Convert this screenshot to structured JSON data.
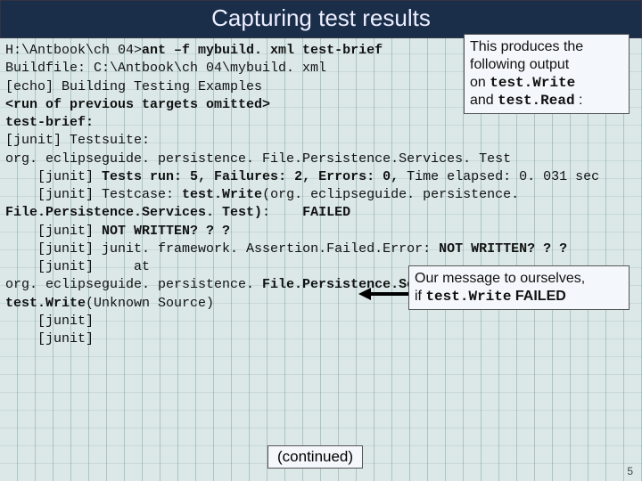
{
  "title": "Capturing test results",
  "callout1": {
    "l1": "This produces the",
    "l2": "following output",
    "l3_a": "on ",
    "l3_code": "test.Write",
    "l4_a": "and ",
    "l4_code": "test.Read",
    "l4_b": " :"
  },
  "callout2": {
    "l1": "Our message to ourselves,",
    "l2_a": "if ",
    "l2_code": "test.Write",
    "l2_b": " FAILED"
  },
  "term": {
    "l1_a": "H:\\Antbook\\ch 04>",
    "l1_b": "ant –f mybuild. xml test-brief",
    "l2": "Buildfile: C:\\Antbook\\ch 04\\mybuild. xml",
    "l3": "     [echo] Building Testing Examples",
    "l4": "<run of previous targets omitted>",
    "l5": "test-brief:",
    "l6": "    [junit] Testsuite:",
    "l7": "org. eclipseguide. persistence. File.Persistence.Services. Test",
    "l8_a": "    [junit] ",
    "l8_b": "Tests run: 5, Failures: 2, Errors: 0, ",
    "l8_c": "Time elapsed: 0. 031 sec",
    "l9_a": "    [junit] Testcase: ",
    "l9_b": "test.Write",
    "l9_c": "(org. eclipseguide. persistence.",
    "l10_a": "File.Persistence.Services. Test)",
    "l10_b": ":    ",
    "l10_c": "FAILED",
    "l11_a": "    [junit] ",
    "l11_b": "NOT WRITTEN? ? ?",
    "l12_a": "    [junit] ",
    "l12_b": "junit. framework. Assertion.Failed.Error: ",
    "l12_c": "NOT WRITTEN? ? ?",
    "l13": "    [junit]     at",
    "l14_a": "org. eclipseguide. persistence. ",
    "l14_b": "File.Persistence.Services. Test. test.Write",
    "l14_c": "(Unknown Source)",
    "l15": "    [junit]",
    "l16": "    [junit]"
  },
  "continued": "(continued)",
  "footer": "5"
}
